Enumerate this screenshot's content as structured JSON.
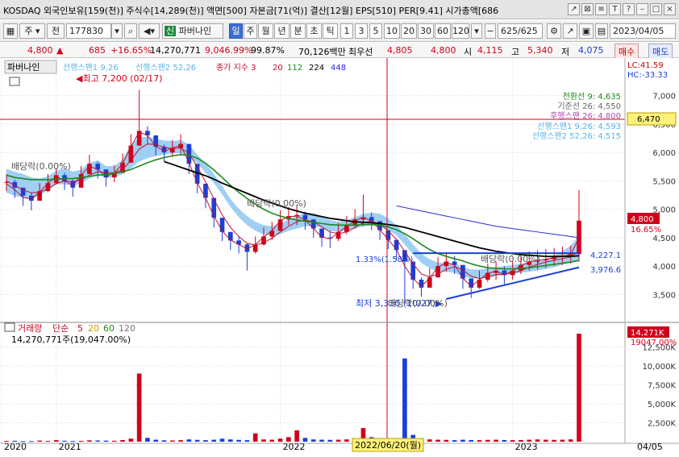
{
  "title": "KOSDAQ 외국인보유[159(천)] 주식수[14,289(천)] 액면[500] 자본금[71(억)] 결산[12월] EPS[510] PER[9.41] 시가총액[686",
  "window_buttons": [
    "↗",
    "⊠",
    "≡",
    "T",
    "?",
    "–",
    "□",
    "×"
  ],
  "toolbar": {
    "market_label": "주",
    "type_label": "전",
    "code": "177830",
    "stock_badge": "신",
    "stock_name": "파버나인",
    "period_tabs": [
      "일",
      "주",
      "월",
      "년",
      "분",
      "초",
      "틱"
    ],
    "minute_tabs": [
      "1",
      "3",
      "5",
      "10",
      "20",
      "30",
      "60",
      "120"
    ],
    "count": "625",
    "count_total": "/625",
    "date": "2023/04/05"
  },
  "quote": {
    "price": "4,800",
    "change": "685",
    "change_pct": "+16.65%",
    "volume": "14,270,771",
    "vol_ratio": "9,046.99%",
    "vol_ratio2": "99.87%",
    "amount": "70,126백만",
    "best_label": "최우선",
    "ask": "4,805",
    "bid": "4,800",
    "open_label": "시",
    "open": "4,115",
    "high_label": "고",
    "high": "5,340",
    "low_label": "저",
    "low": "4,075",
    "buy_label": "매수",
    "sell_label": "매도"
  },
  "colors": {
    "up": "#d0021b",
    "down": "#1a3fd6",
    "ichimoku_cloud": "#8ec7f2",
    "ma3": "#c0102a",
    "ma20": "#c0102a",
    "ma112": "#1c8a1c",
    "ma224": "#000000",
    "ma448": "#2b2bd0"
  },
  "panel_price": {
    "stock_label": "파버나인",
    "legend_ichimoku": [
      "선행스팬1 9,26",
      "선행스팬2 52,26"
    ],
    "legend_ma": "종가 지수 3",
    "ma_periods": [
      "20",
      "112",
      "224",
      "448"
    ],
    "hi_lo": [
      "LC:41.59",
      "HC:-33.33"
    ],
    "ichimoku_values": [
      "전환선 9: 4,635",
      "기준선 26: 4,550",
      "후행스팬 26: 4,800",
      "선행스팬1 9,26: 4,593",
      "선행스팬2 52,26: 4,515"
    ],
    "hline_value": "6,470",
    "current_price": "4,800",
    "current_pct": "16.65%",
    "max_label": "최고 7,200 (02/17)",
    "min_label": "최저 3,330 (10/27)",
    "dividend_labels": [
      "배당락(0.00%)",
      "배당락(0.00%)",
      "배당락(0.00%)",
      "배당락(0.00%)"
    ],
    "trend_labels": [
      "4,227.1",
      "3,976.6",
      "1.33%(1.58%)"
    ]
  },
  "panel_volume": {
    "legend_title": "거래량",
    "legend_ma": "단순",
    "ma_periods": [
      "5",
      "20",
      "60",
      "120"
    ],
    "volume_readout": "14,270,771주(19,047.00%)",
    "side_top": "14,271K",
    "side_pct": "19047.00%"
  },
  "x_axis": {
    "ticks": [
      "2020",
      "2021",
      "2022",
      "2023"
    ],
    "cursor_date": "2022/06/20(월)",
    "end_label": "04/05"
  },
  "chart_data": [
    {
      "type": "candlestick",
      "title": "파버나인",
      "y_ticks": [
        7000,
        6500,
        6000,
        5500,
        5000,
        4500,
        4000,
        3500
      ],
      "y_tick_labels": [
        "7,000",
        "6,500",
        "6,000",
        "5,500",
        "5,000",
        "4,500",
        "4,000",
        "3,500"
      ],
      "ylim": [
        3150,
        7350
      ],
      "x_ticks": [
        "2020",
        "2021",
        "2022",
        "2023"
      ],
      "close_approx": [
        5480,
        5380,
        5240,
        5150,
        5320,
        5460,
        5600,
        5500,
        5380,
        5620,
        5800,
        5700,
        5560,
        5640,
        5820,
        6120,
        6380,
        6300,
        6100,
        6000,
        6080,
        6150,
        5800,
        5450,
        5200,
        4850,
        4600,
        4450,
        4380,
        4250,
        4380,
        4520,
        4620,
        4820,
        4880,
        4900,
        4820,
        4660,
        4500,
        4480,
        4600,
        4720,
        4820,
        4860,
        4790,
        4630,
        4460,
        4280,
        4080,
        3760,
        3620,
        3800,
        4000,
        4080,
        4020,
        3780,
        3620,
        3760,
        3880,
        3920,
        3840,
        3920,
        4020,
        4080,
        4100,
        4120,
        4160,
        4180,
        4210,
        4800
      ],
      "high_approx": [
        5620,
        5520,
        5380,
        5300,
        5460,
        5620,
        5720,
        5640,
        5520,
        5760,
        5960,
        5840,
        5700,
        5780,
        5980,
        6320,
        7100,
        6460,
        6240,
        6140,
        6220,
        6320,
        5960,
        5600,
        5360,
        5000,
        4760,
        4600,
        4520,
        4400,
        4520,
        4680,
        4780,
        4980,
        5040,
        5080,
        4960,
        4800,
        4660,
        4620,
        4760,
        4880,
        5000,
        5260,
        4940,
        4780,
        4600,
        4420,
        4240,
        3920,
        3800,
        3960,
        4160,
        4240,
        4180,
        3940,
        3780,
        3920,
        4040,
        4080,
        4000,
        4080,
        4180,
        4260,
        4280,
        4300,
        4320,
        4340,
        4360,
        5340
      ],
      "low_approx": [
        5320,
        5200,
        5060,
        4980,
        5160,
        5300,
        5440,
        5340,
        5220,
        5460,
        5640,
        5540,
        5400,
        5480,
        5660,
        5940,
        6160,
        6140,
        5940,
        5840,
        5920,
        5960,
        5620,
        5280,
        5020,
        4680,
        4440,
        4280,
        4220,
        3920,
        4220,
        4360,
        4460,
        4640,
        4720,
        4720,
        4640,
        4500,
        4340,
        4320,
        4440,
        4560,
        4660,
        4700,
        4630,
        4460,
        4300,
        4100,
        3380,
        3600,
        3460,
        3640,
        3840,
        3900,
        3860,
        3600,
        3440,
        3600,
        3720,
        3760,
        3680,
        3760,
        3860,
        3920,
        3940,
        3960,
        4000,
        4020,
        4040,
        4075
      ],
      "series": [
        {
          "name": "3",
          "values": [
            5450,
            5340,
            5210,
            5180,
            5300,
            5460,
            5580,
            5500,
            5420,
            5600,
            5760,
            5700,
            5580,
            5640,
            5800,
            6100,
            6360,
            6300,
            6110,
            6020,
            6080,
            6120,
            5820,
            5460,
            5200,
            4880,
            4620,
            4460,
            4380,
            4300,
            4380,
            4510,
            4620,
            4800,
            4870,
            4880,
            4810,
            4660,
            4510,
            4480,
            4590,
            4700,
            4800,
            4860,
            4790,
            4640,
            4470,
            4290,
            4000,
            3780,
            3640,
            3790,
            3980,
            4060,
            4020,
            3790,
            3640,
            3760,
            3870,
            3910,
            3850,
            3910,
            4010,
            4070,
            4100,
            4120,
            4150,
            4170,
            4200,
            4500
          ]
        },
        {
          "name": "20",
          "values": [
            5500,
            5420,
            5340,
            5290,
            5300,
            5360,
            5450,
            5500,
            5480,
            5520,
            5600,
            5660,
            5650,
            5640,
            5700,
            5860,
            6060,
            6150,
            6140,
            6090,
            6070,
            6080,
            5980,
            5750,
            5480,
            5180,
            4900,
            4680,
            4520,
            4400,
            4370,
            4410,
            4490,
            4600,
            4700,
            4780,
            4810,
            4780,
            4690,
            4600,
            4570,
            4600,
            4680,
            4760,
            4790,
            4740,
            4620,
            4470,
            4260,
            4040,
            3860,
            3810,
            3860,
            3940,
            3990,
            3930,
            3820,
            3780,
            3810,
            3850,
            3860,
            3880,
            3920,
            3980,
            4030,
            4070,
            4100,
            4130,
            4160,
            4260
          ]
        },
        {
          "name": "112",
          "values": [
            5600,
            5560,
            5540,
            5520,
            5520,
            5520,
            5530,
            5540,
            5540,
            5560,
            5580,
            5600,
            5610,
            5630,
            5660,
            5700,
            5760,
            5820,
            5870,
            5910,
            5940,
            5960,
            5950,
            5900,
            5810,
            5690,
            5560,
            5420,
            5300,
            5190,
            5090,
            5000,
            4930,
            4880,
            4840,
            4810,
            4790,
            4770,
            4750,
            4730,
            4720,
            4720,
            4720,
            4730,
            4730,
            4720,
            4690,
            4640,
            4570,
            4480,
            4380,
            4290,
            4220,
            4170,
            4130,
            4090,
            4040,
            4000,
            3970,
            3960,
            3950,
            3950,
            3960,
            3970,
            3990,
            4010,
            4030,
            4050,
            4070,
            4100
          ]
        },
        {
          "name": "224",
          "values": [
            null,
            null,
            null,
            null,
            null,
            null,
            null,
            null,
            null,
            null,
            null,
            null,
            null,
            null,
            null,
            null,
            null,
            null,
            null,
            5840,
            5790,
            5740,
            5690,
            5640,
            5590,
            5530,
            5460,
            5400,
            5340,
            5280,
            5220,
            5160,
            5110,
            5060,
            5010,
            4970,
            4930,
            4900,
            4870,
            4840,
            4820,
            4800,
            4780,
            4770,
            4760,
            4750,
            4730,
            4710,
            4680,
            4640,
            4600,
            4560,
            4520,
            4480,
            4440,
            4400,
            4360,
            4320,
            4290,
            4260,
            4240,
            4220,
            4200,
            4190,
            4180,
            4170,
            4170,
            4170,
            4170,
            4180
          ]
        },
        {
          "name": "448",
          "values": [
            null,
            null,
            null,
            null,
            null,
            null,
            null,
            null,
            null,
            null,
            null,
            null,
            null,
            null,
            null,
            null,
            null,
            null,
            null,
            null,
            null,
            null,
            null,
            null,
            null,
            null,
            null,
            null,
            null,
            null,
            null,
            null,
            null,
            null,
            null,
            null,
            null,
            null,
            null,
            null,
            null,
            null,
            null,
            null,
            null,
            null,
            null,
            5060,
            5030,
            5000,
            4970,
            4940,
            4910,
            4880,
            4850,
            4820,
            4790,
            4760,
            4730,
            4700,
            4680,
            4660,
            4640,
            4620,
            4600,
            4580,
            4560,
            4540,
            4520,
            4500
          ]
        }
      ],
      "ichimoku_cloud_approx": [
        [
          5650,
          5350
        ],
        [
          5600,
          5300
        ],
        [
          5560,
          5260
        ],
        [
          5500,
          5240
        ],
        [
          5480,
          5300
        ],
        [
          5520,
          5400
        ],
        [
          5620,
          5500
        ],
        [
          5660,
          5500
        ],
        [
          5600,
          5470
        ],
        [
          5640,
          5520
        ],
        [
          5760,
          5600
        ],
        [
          5800,
          5660
        ],
        [
          5700,
          5620
        ],
        [
          5700,
          5620
        ],
        [
          5820,
          5680
        ],
        [
          6080,
          5780
        ],
        [
          6200,
          5900
        ],
        [
          6220,
          5960
        ],
        [
          6180,
          6000
        ],
        [
          6150,
          6020
        ],
        [
          6140,
          6040
        ],
        [
          6160,
          6050
        ],
        [
          6080,
          5990
        ],
        [
          5900,
          5870
        ],
        [
          5750,
          5700
        ],
        [
          5560,
          5520
        ],
        [
          5350,
          5320
        ],
        [
          5120,
          5100
        ],
        [
          4950,
          4920
        ],
        [
          4820,
          4780
        ],
        [
          4720,
          4680
        ],
        [
          4660,
          4620
        ],
        [
          4640,
          4600
        ],
        [
          4680,
          4620
        ],
        [
          4760,
          4680
        ],
        [
          4820,
          4720
        ],
        [
          4880,
          4760
        ],
        [
          4870,
          4760
        ],
        [
          4820,
          4730
        ],
        [
          4750,
          4680
        ],
        [
          4720,
          4660
        ],
        [
          4750,
          4680
        ],
        [
          4800,
          4720
        ],
        [
          4860,
          4760
        ],
        [
          4880,
          4780
        ],
        [
          4860,
          4760
        ],
        [
          4780,
          4700
        ],
        [
          4660,
          4600
        ],
        [
          4500,
          4440
        ],
        [
          4320,
          4260
        ],
        [
          4160,
          4120
        ],
        [
          4060,
          4020
        ],
        [
          4000,
          3960
        ],
        [
          4000,
          3960
        ],
        [
          3980,
          3940
        ],
        [
          3920,
          3880
        ],
        [
          3880,
          3840
        ],
        [
          3880,
          3840
        ],
        [
          3900,
          3860
        ],
        [
          3920,
          3880
        ],
        [
          3940,
          3900
        ],
        [
          3960,
          3920
        ],
        [
          3980,
          3940
        ],
        [
          4000,
          3960
        ],
        [
          4020,
          3980
        ],
        [
          4060,
          4010
        ],
        [
          4120,
          4040
        ],
        [
          4200,
          4080
        ],
        [
          4300,
          4120
        ],
        [
          4480,
          4180
        ]
      ],
      "trendlines": [
        {
          "from": [
            49,
            4227.1
          ],
          "to": [
            69,
            4227.1
          ]
        },
        {
          "from": [
            53,
            3420
          ],
          "to": [
            69,
            3976.6
          ]
        }
      ]
    },
    {
      "type": "bar",
      "title": "거래량",
      "y_ticks": [
        12500,
        10000,
        7500,
        5000,
        2500
      ],
      "y_tick_labels": [
        "12,500K",
        "10,000K",
        "7,500K",
        "5,000K",
        "2,500K"
      ],
      "ylim": [
        0,
        14271
      ],
      "values_k_approx": [
        90,
        120,
        60,
        80,
        150,
        100,
        200,
        120,
        90,
        110,
        180,
        160,
        140,
        120,
        220,
        400,
        9000,
        500,
        260,
        180,
        160,
        200,
        300,
        240,
        200,
        260,
        400,
        300,
        240,
        200,
        1100,
        300,
        260,
        400,
        600,
        1500,
        500,
        300,
        260,
        240,
        260,
        300,
        400,
        1800,
        600,
        400,
        300,
        260,
        11000,
        900,
        400,
        300,
        260,
        240,
        200,
        260,
        220,
        200,
        240,
        260,
        220,
        200,
        220,
        260,
        300,
        260,
        240,
        260,
        300,
        14271
      ]
    }
  ]
}
